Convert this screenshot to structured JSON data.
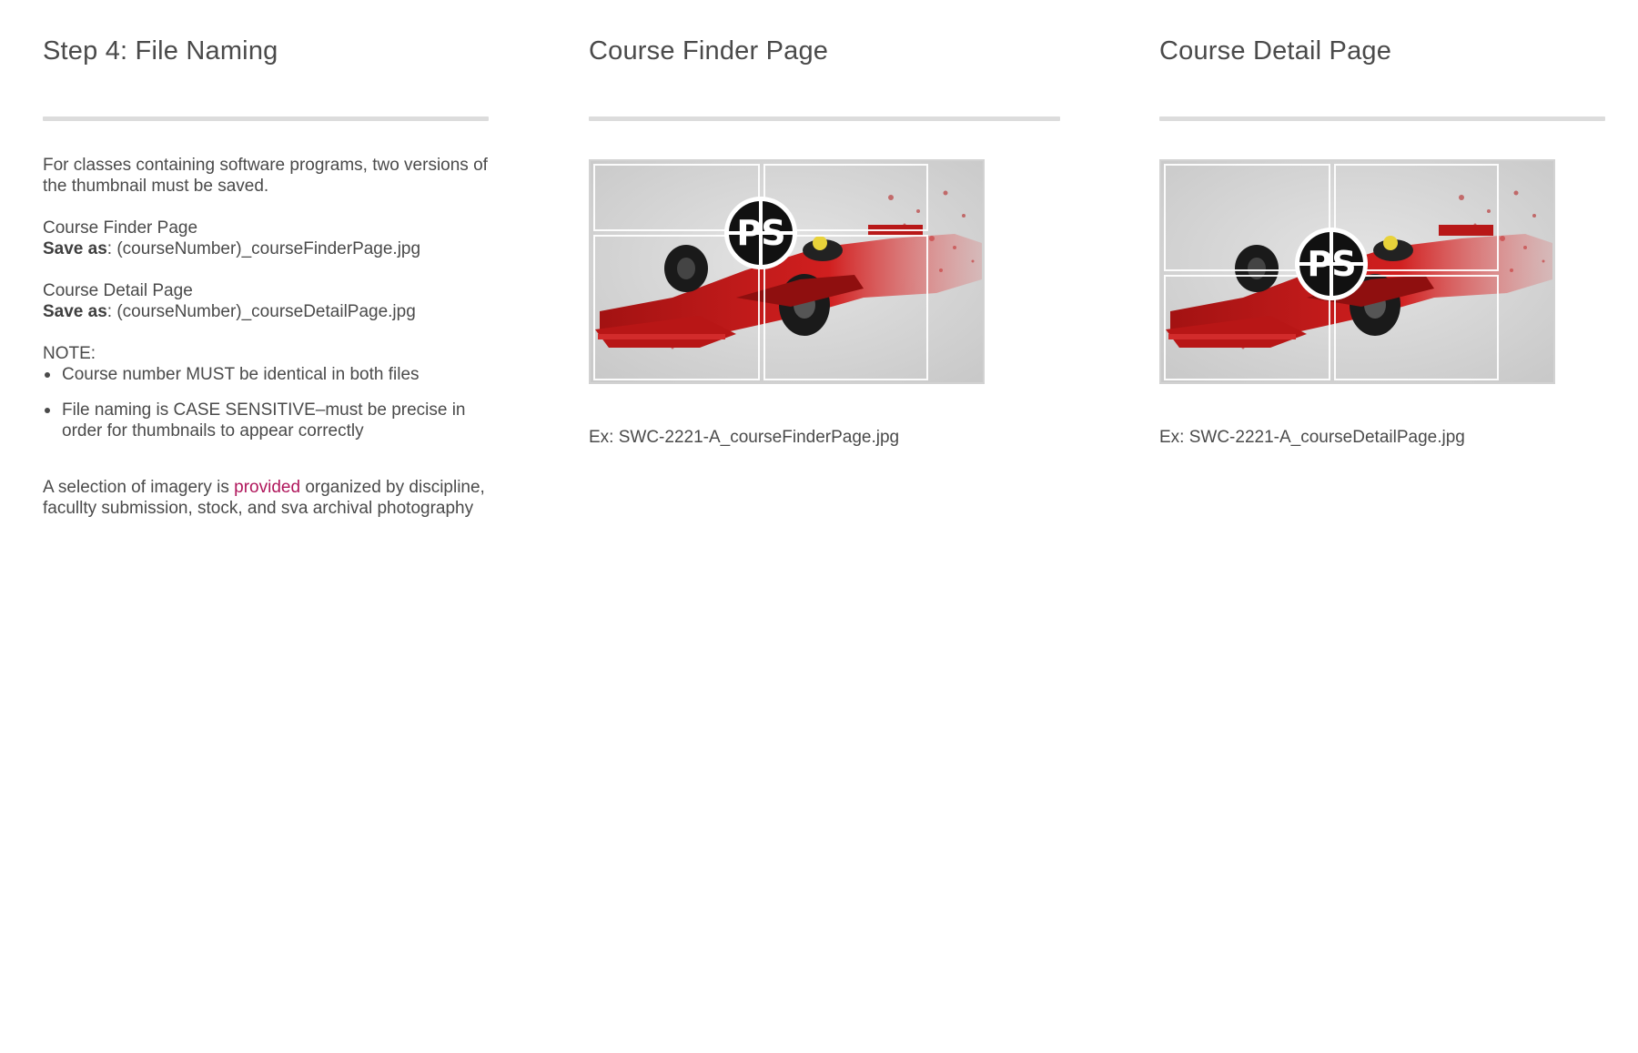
{
  "step": {
    "heading": "Step 4: File Naming",
    "intro": "For classes containing software programs, two versions of the thumbnail must be saved.",
    "finder_label": "Course Finder Page",
    "finder_save_prefix": "Save as",
    "finder_save_value": ": (courseNumber)_courseFinderPage.jpg",
    "detail_label": "Course Detail Page",
    "detail_save_prefix": "Save as",
    "detail_save_value": ": (courseNumber)_courseDetailPage.jpg",
    "note_label": "NOTE:",
    "notes": [
      "Course number MUST be identical in both files",
      "File naming is CASE SENSITIVE–must be precise in order for thumbnails to appear correctly"
    ],
    "selection_before": "A selection of imagery is ",
    "selection_link": "provided",
    "selection_after": " organized by discipline, facullty submission, stock, and sva archival photography"
  },
  "finder_column": {
    "heading": "Course Finder Page",
    "badge_text": "PS",
    "example": "Ex: SWC-2221-A_courseFinderPage.jpg"
  },
  "detail_column": {
    "heading": "Course Detail Page",
    "badge_text": "PS",
    "example": "Ex: SWC-2221-A_courseDetailPage.jpg"
  },
  "colors": {
    "text": "#4a4a4a",
    "rule": "#dcdcdc",
    "link": "#b0175c",
    "car_red": "#c41a1a"
  },
  "icons": {
    "thumbnail_image": "race-car-thumbnail",
    "badge": "photoshop-badge-icon"
  }
}
